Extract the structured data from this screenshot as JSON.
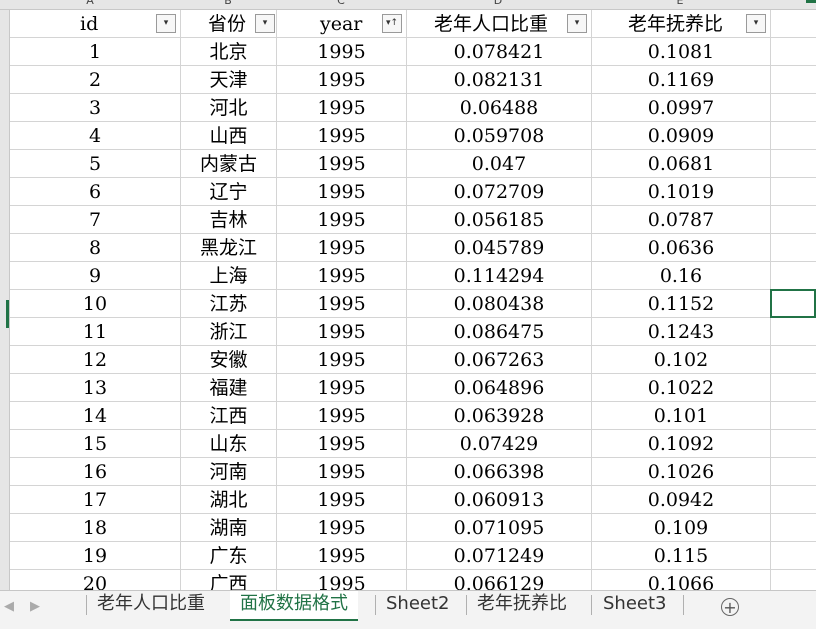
{
  "columns": {
    "letters": [
      "A",
      "B",
      "C",
      "D",
      "E"
    ]
  },
  "headers": [
    "id",
    "省份",
    "year",
    "老年人口比重",
    "老年抚养比"
  ],
  "filter_icons": {
    "normal": "▾",
    "sorted": "▾↑"
  },
  "rows": [
    [
      "1",
      "北京",
      "1995",
      "0.078421",
      "0.1081"
    ],
    [
      "2",
      "天津",
      "1995",
      "0.082131",
      "0.1169"
    ],
    [
      "3",
      "河北",
      "1995",
      "0.06488",
      "0.0997"
    ],
    [
      "4",
      "山西",
      "1995",
      "0.059708",
      "0.0909"
    ],
    [
      "5",
      "内蒙古",
      "1995",
      "0.047",
      "0.0681"
    ],
    [
      "6",
      "辽宁",
      "1995",
      "0.072709",
      "0.1019"
    ],
    [
      "7",
      "吉林",
      "1995",
      "0.056185",
      "0.0787"
    ],
    [
      "8",
      "黑龙江",
      "1995",
      "0.045789",
      "0.0636"
    ],
    [
      "9",
      "上海",
      "1995",
      "0.114294",
      "0.16"
    ],
    [
      "10",
      "江苏",
      "1995",
      "0.080438",
      "0.1152"
    ],
    [
      "11",
      "浙江",
      "1995",
      "0.086475",
      "0.1243"
    ],
    [
      "12",
      "安徽",
      "1995",
      "0.067263",
      "0.102"
    ],
    [
      "13",
      "福建",
      "1995",
      "0.064896",
      "0.1022"
    ],
    [
      "14",
      "江西",
      "1995",
      "0.063928",
      "0.101"
    ],
    [
      "15",
      "山东",
      "1995",
      "0.07429",
      "0.1092"
    ],
    [
      "16",
      "河南",
      "1995",
      "0.066398",
      "0.1026"
    ],
    [
      "17",
      "湖北",
      "1995",
      "0.060913",
      "0.0942"
    ],
    [
      "18",
      "湖南",
      "1995",
      "0.071095",
      "0.109"
    ],
    [
      "19",
      "广东",
      "1995",
      "0.071249",
      "0.115"
    ],
    [
      "20",
      "广西",
      "1995",
      "0.066129",
      "0.1066"
    ]
  ],
  "tabs": {
    "items": [
      "老年人口比重",
      "面板数据格式",
      "Sheet2",
      "老年抚养比",
      "Sheet3"
    ],
    "active": "面板数据格式"
  },
  "nav": {
    "prev": "◀",
    "next": "▶",
    "add": "+"
  },
  "colors": {
    "accent": "#217346"
  }
}
